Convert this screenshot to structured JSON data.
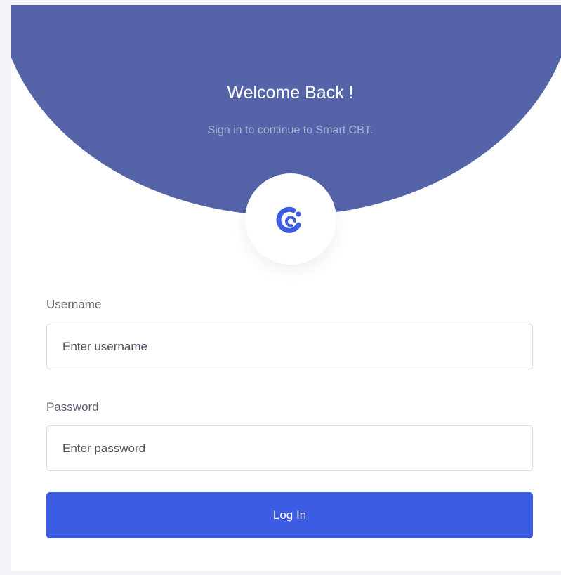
{
  "header": {
    "title": "Welcome Back !",
    "subtitle": "Sign in to continue to Smart CBT."
  },
  "logo": {
    "icon": "smart-cbt-logo-icon",
    "color": "#3c5ce4"
  },
  "form": {
    "username": {
      "label": "Username",
      "placeholder": "Enter username",
      "value": ""
    },
    "password": {
      "label": "Password",
      "placeholder": "Enter password",
      "value": ""
    },
    "submit_label": "Log In"
  },
  "colors": {
    "banner": "#5564a8",
    "accent": "#3c5ce4",
    "background": "#f1f3f8"
  }
}
